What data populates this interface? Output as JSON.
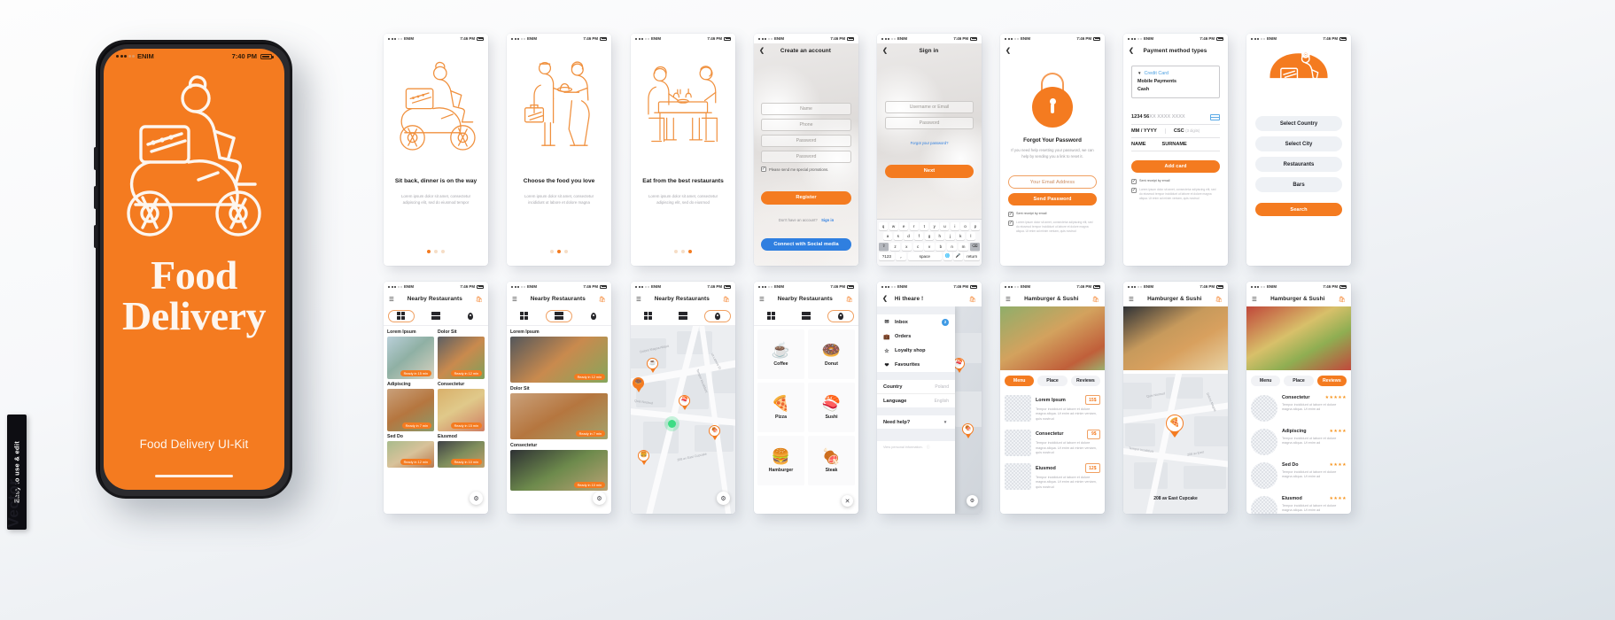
{
  "status_bar": {
    "carrier": "ENIM",
    "time": "7:40 PM",
    "time_small": "7:46 PM"
  },
  "hero": {
    "title_line1": "Food",
    "title_line2": "Delivery",
    "subtitle": "Food Delivery UI-Kit",
    "carrier": "ENIM",
    "time": "7:40 PM"
  },
  "vector_tab": {
    "rotated_label": "Easy to use & edit",
    "word": "Vector"
  },
  "onboarding": [
    {
      "heading": "Sit back, dinner is on the way",
      "body": "Lorem ipsum dolor sit amet, consectetur adipiscing elit, sed do eiusmod tempor",
      "active_dot": 0,
      "art": "scooter-delivery-illustration"
    },
    {
      "heading": "Choose the food you love",
      "body": "Lorem ipsum dolor sit amet, consectetur incididunt ut labore et dolore magna",
      "active_dot": 1,
      "art": "handoff-illustration"
    },
    {
      "heading": "Eat from the best restaurants",
      "body": "Lorem ipsum dolor sit amet, consectetur adipiscing elit, sed do eiusmod",
      "active_dot": 2,
      "art": "dining-table-illustration"
    }
  ],
  "create_account": {
    "title": "Create an account",
    "fields": [
      "Name",
      "Phone",
      "Password",
      "Password"
    ],
    "checkbox_label": "Please send me special promotions.",
    "primary_button": "Register",
    "footer_text": "Don't have an account?",
    "footer_link": "Sign in",
    "social_button": "Connect with Social media",
    "social_color": "#2f7fe0"
  },
  "sign_in": {
    "title": "Sign in",
    "fields": [
      "Username or Email",
      "Password"
    ],
    "forgot_link": "Forgot your password?",
    "primary_button": "Next",
    "keyboard": {
      "row1": [
        "q",
        "w",
        "e",
        "r",
        "t",
        "y",
        "u",
        "i",
        "o",
        "p"
      ],
      "row2": [
        "a",
        "s",
        "d",
        "f",
        "g",
        "h",
        "j",
        "k",
        "l"
      ],
      "row3": [
        "z",
        "x",
        "c",
        "v",
        "b",
        "n",
        "m"
      ],
      "row4": [
        "?123",
        ",.",
        "space",
        "globe-icon",
        "mic-icon",
        "return"
      ]
    }
  },
  "forgot_password": {
    "heading": "Forgot Your Password",
    "body": "If you need help resetting your password, we can help by sending you a link to reset it.",
    "email_placeholder": "Your Email Address",
    "primary_button": "Send Password",
    "checkbox_1": "Sent receipt by email",
    "checkbox_2": "Lorem ipsum dolor sit amet, consectetur adipiscing elit, sed do eiusmod tempor incididunt ut labore et dolore magna aliqua. Ut enim ad minim veniam, quis nostrud",
    "icon": "padlock-icon"
  },
  "payment": {
    "title": "Payment method types",
    "options": [
      "Credit Card",
      "Mobile Payments",
      "Cash"
    ],
    "selected_option": "Credit Card",
    "card_number_typed": "1234  56",
    "card_number_mask": "XX  XXXX  XXXX",
    "expiry_label": "MM / YYYY",
    "csc_label": "CSC",
    "csc_hint": "(3 digits)",
    "name_label": "NAME",
    "surname_label": "SURNAME",
    "primary_button": "Add card",
    "checkbox_1": "Sent receipt by email",
    "checkbox_2": "Lorem ipsum dolor sit amet, consectetur adipiscing elit, sed do eiusmod tempor incididunt ut labore et dolore magna aliqua. Ut enim ad minim veniam, quis nostrud"
  },
  "select_screen": {
    "buttons": [
      "Select Country",
      "Select City",
      "Restaurants",
      "Bars"
    ],
    "primary_button": "Search",
    "art": "scooter-badge-illustration"
  },
  "nearby": {
    "title": "Nearby Restaurants",
    "toolbar": [
      "grid-view-icon",
      "list-view-icon",
      "map-view-icon"
    ],
    "menu_icon": "hamburger-menu-icon",
    "bag_icon": "shopping-bag-icon",
    "grid_view": {
      "active": "grid-view-icon",
      "cards": [
        {
          "label": "Lorem Ipsum",
          "badge": "Ready in 15  min"
        },
        {
          "label": "Dolor Sit",
          "badge": "Ready in 12  min"
        },
        {
          "label": "Adipiscing",
          "badge": "Ready in 7  min"
        },
        {
          "label": "Consectetur",
          "badge": "Ready in 15  min"
        },
        {
          "label": "Sed Do",
          "badge": "Ready in 12  min"
        },
        {
          "label": "Eiusmod",
          "badge": "Ready in 10  min"
        }
      ],
      "fab": "filter-icon"
    },
    "list_view": {
      "active": "list-view-icon",
      "cards": [
        {
          "label": "Lorem Ipsum",
          "badge": "Ready in 12  min"
        },
        {
          "label": "Dolor Sit",
          "badge": "Ready in 7  min"
        },
        {
          "label": "Consectetur",
          "badge": "Ready in 10  min"
        }
      ],
      "fab": "filter-icon"
    },
    "map_view": {
      "active": "map-view-icon",
      "street_labels": [
        "Dolore Magna Aliqua",
        "Tempor Incididunt",
        "Ut Labore Et",
        "Quis Nostrud",
        "208 av East Cupcake"
      ],
      "pins": [
        "coffee-pin",
        "donut-pin",
        "sushi-pin",
        "steak-pin",
        "hamburger-pin"
      ],
      "fab": "filter-icon"
    },
    "category_view": {
      "active": "map-view-icon",
      "categories": [
        {
          "name": "Coffee",
          "icon": "coffee-cup-icon"
        },
        {
          "name": "Donut",
          "icon": "donut-icon"
        },
        {
          "name": "Pizza",
          "icon": "pizza-slice-icon"
        },
        {
          "name": "Sushi",
          "icon": "sushi-icon"
        },
        {
          "name": "Hamburger",
          "icon": "hamburger-icon"
        },
        {
          "name": "Steak",
          "icon": "steak-icon"
        }
      ],
      "close": "close-icon"
    }
  },
  "drawer": {
    "title": "Hi theare !",
    "items": [
      {
        "label": "Inbox",
        "icon": "envelope-icon",
        "badge": "2"
      },
      {
        "label": "Orders",
        "icon": "bag-icon",
        "badge": ""
      },
      {
        "label": "Loyalty shop",
        "icon": "star-icon",
        "badge": ""
      },
      {
        "label": "Favourites",
        "icon": "heart-icon",
        "badge": ""
      }
    ],
    "settings": [
      {
        "label": "Country",
        "value": "Poland"
      },
      {
        "label": "Language",
        "value": "English"
      }
    ],
    "help_label": "Need help?",
    "help_chevron": "chevron-down-icon",
    "footer": "View personal information.",
    "badge_color": "#3e9ae5"
  },
  "restaurant": {
    "title": "Hamburger  &  Sushi",
    "tabs": [
      "Menu",
      "Place",
      "Reviews"
    ],
    "menu_tab": {
      "active": "Menu",
      "items": [
        {
          "name": "Lorem Ipsum",
          "price": "15$",
          "desc": "Tempor incididunt ut labore et dolore magna aliqua. Ut enim ad minim veniam, quis nostrud"
        },
        {
          "name": "Consectetur",
          "price": "9$",
          "desc": "Tempor incididunt ut labore et dolore magna aliqua. Ut enim ad minim veniam, quis nostrud"
        },
        {
          "name": "Eiusmod",
          "price": "12$",
          "desc": "Tempor incididunt ut labore et dolore magna aliqua. Ut enim ad minim veniam, quis nostrud"
        }
      ]
    },
    "place_tab": {
      "active": "Place",
      "pin": "pizza-pin",
      "address": "208 av East Cupcake",
      "street_labels": [
        "Quis Nostrud",
        "Dolore Magna",
        "Tempor Incididunt",
        "208 av East"
      ]
    },
    "reviews_tab": {
      "active": "Reviews",
      "items": [
        {
          "name": "Consectetur",
          "stars": 5,
          "desc": "Tempor incididunt ut labore et dolore magna aliqua. Ut enim ad"
        },
        {
          "name": "Adipiscing",
          "stars": 4,
          "desc": "Tempor incididunt ut labore et dolore magna aliqua. Ut enim ad"
        },
        {
          "name": "Sed Do",
          "stars": 4,
          "desc": "Tempor incididunt ut labore et dolore magna aliqua. Ut enim ad"
        },
        {
          "name": "Eiusmod",
          "stars": 4,
          "desc": "Tempor incididunt ut labore et dolore magna aliqua. Ut enim ad"
        }
      ]
    }
  },
  "colors": {
    "accent": "#f47b20",
    "blue": "#2f7fe0",
    "dark": "#1d1d1f",
    "muted": "#a9a9af"
  }
}
